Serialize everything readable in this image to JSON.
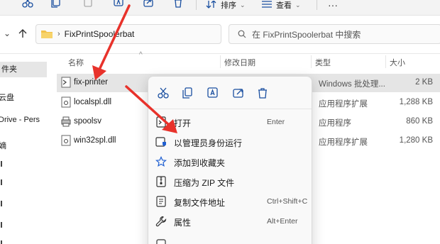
{
  "toolbar": {
    "sort_label": "排序",
    "view_label": "查看",
    "icons": [
      "cut-icon",
      "copy-icon",
      "paste-icon",
      "rename-icon",
      "share-icon",
      "delete-icon"
    ]
  },
  "address": {
    "path": "FixPrintSpoolerbat",
    "search_placeholder": "在 FixPrintSpoolerbat 中搜索"
  },
  "sidebar": {
    "items": [
      "件夹",
      "云盘",
      "Drive - Pers",
      "嫡",
      "",
      "",
      "",
      "",
      ""
    ]
  },
  "columns": {
    "name": "名称",
    "modified": "修改日期",
    "type": "类型",
    "size": "大小"
  },
  "files": [
    {
      "name": "fix-printer",
      "type": "Windows 批处理...",
      "size": "2 KB"
    },
    {
      "name": "localspl.dll",
      "type": "应用程序扩展",
      "size": "1,288 KB"
    },
    {
      "name": "spoolsv",
      "type": "应用程序",
      "size": "860 KB"
    },
    {
      "name": "win32spl.dll",
      "type": "应用程序扩展",
      "size": "1,280 KB"
    }
  ],
  "context_menu": {
    "quick_actions": [
      "cut-icon",
      "copy-icon",
      "rename-icon",
      "share-icon",
      "delete-icon"
    ],
    "items": [
      {
        "label": "打开",
        "shortcut": "Enter"
      },
      {
        "label": "以管理员身份运行",
        "shortcut": ""
      },
      {
        "label": "添加到收藏夹",
        "shortcut": ""
      },
      {
        "label": "压缩为 ZIP 文件",
        "shortcut": ""
      },
      {
        "label": "复制文件地址",
        "shortcut": "Ctrl+Shift+C"
      },
      {
        "label": "属性",
        "shortcut": "Alt+Enter"
      },
      {
        "label": "",
        "shortcut": ""
      }
    ]
  },
  "colors": {
    "accent": "#e8322b",
    "selection": "#e5e5e5"
  }
}
